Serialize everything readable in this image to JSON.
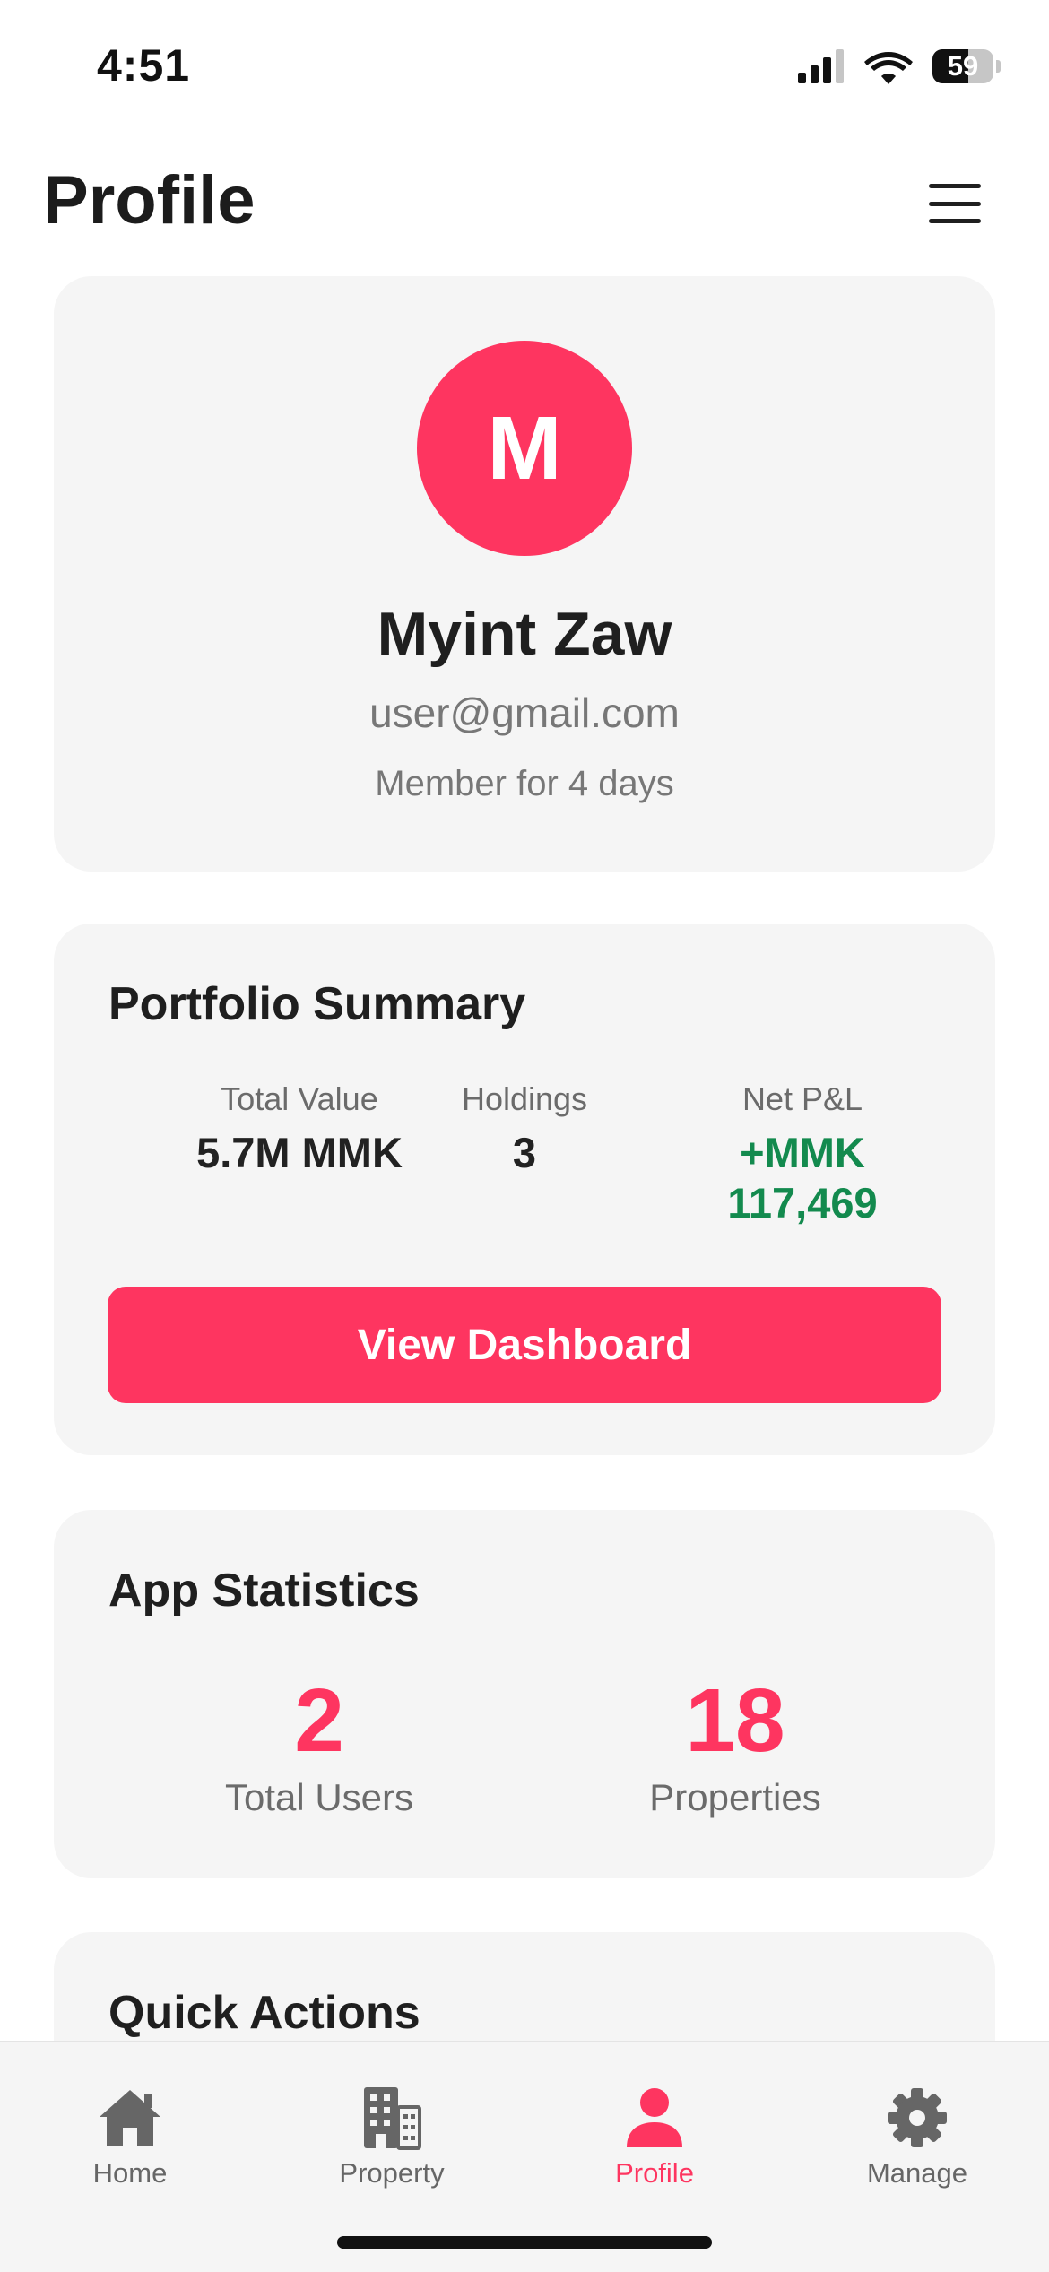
{
  "status_bar": {
    "time": "4:51",
    "battery_level": "59",
    "battery_fraction": 0.59,
    "icons": [
      "cellular-signal-icon",
      "wifi-icon",
      "battery-icon"
    ]
  },
  "header": {
    "title": "Profile",
    "menu_icon": "hamburger-menu-icon"
  },
  "profile": {
    "avatar_initial": "M",
    "name": "Myint Zaw",
    "email": "user@gmail.com",
    "member_since": "Member for 4 days"
  },
  "portfolio_summary": {
    "title": "Portfolio Summary",
    "metrics": [
      {
        "label": "Total Value",
        "value": "5.7M MMK"
      },
      {
        "label": "Holdings",
        "value": "3"
      },
      {
        "label": "Net P&L",
        "value": "+MMK 117,469"
      }
    ],
    "button_label": "View Dashboard"
  },
  "app_statistics": {
    "title": "App Statistics",
    "stats": [
      {
        "value": "2",
        "label": "Total Users"
      },
      {
        "value": "18",
        "label": "Properties"
      }
    ]
  },
  "quick_actions": {
    "title": "Quick Actions"
  },
  "tab_bar": {
    "tabs": [
      {
        "label": "Home",
        "icon": "home-icon",
        "active": false
      },
      {
        "label": "Property",
        "icon": "building-icon",
        "active": false
      },
      {
        "label": "Profile",
        "icon": "person-icon",
        "active": true
      },
      {
        "label": "Manage",
        "icon": "gear-icon",
        "active": false
      }
    ]
  },
  "colors": {
    "accent": "#fe3560",
    "positive": "#138a4e",
    "card_background": "#f5f5f5",
    "muted_text": "#777777",
    "inactive_tab": "#666666"
  }
}
